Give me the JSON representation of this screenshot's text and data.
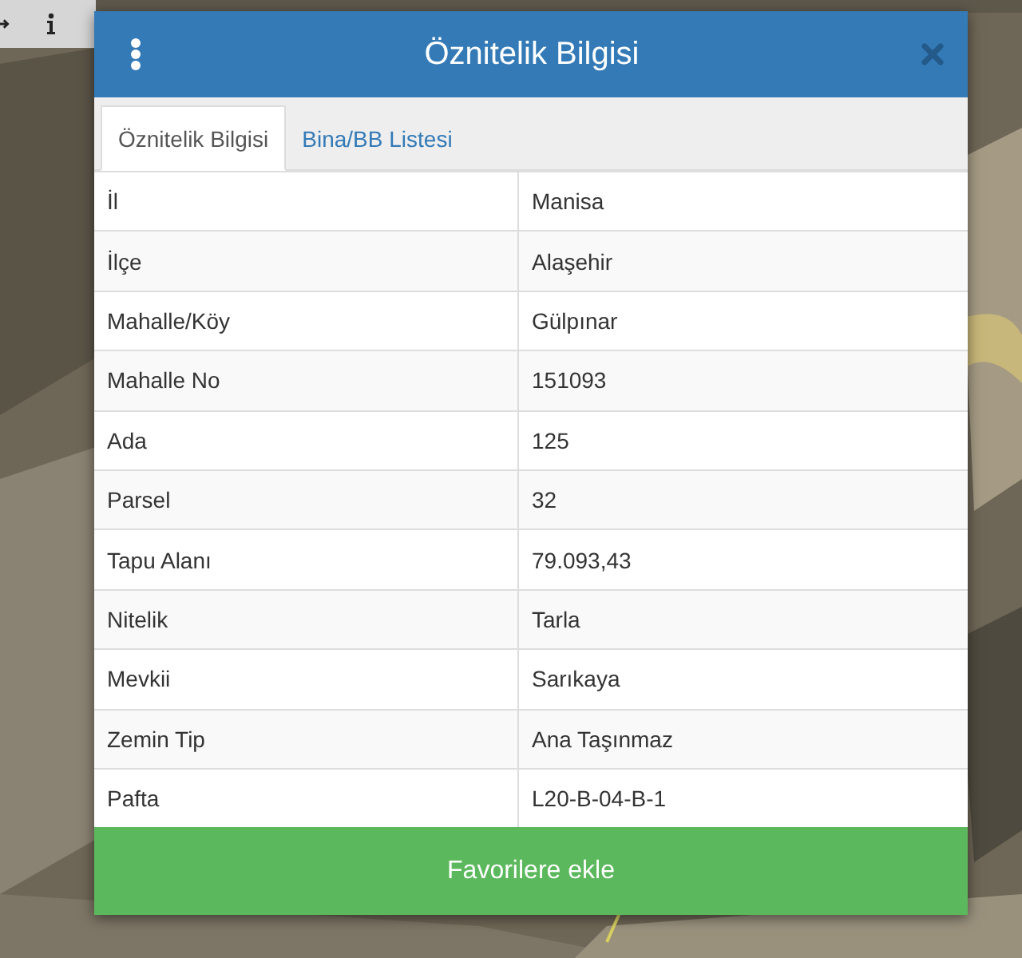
{
  "dialog": {
    "title": "Öznitelik Bilgisi"
  },
  "tabs": [
    {
      "label": "Öznitelik Bilgisi",
      "selected": true
    },
    {
      "label": "Bina/BB Listesi",
      "selected": false
    }
  ],
  "rows": [
    {
      "label": "İl",
      "value": "Manisa"
    },
    {
      "label": "İlçe",
      "value": "Alaşehir"
    },
    {
      "label": "Mahalle/Köy",
      "value": "Gülpınar"
    },
    {
      "label": "Mahalle No",
      "value": "151093"
    },
    {
      "label": "Ada",
      "value": "125"
    },
    {
      "label": "Parsel",
      "value": "32"
    },
    {
      "label": "Tapu Alanı",
      "value": "79.093,43"
    },
    {
      "label": "Nitelik",
      "value": "Tarla"
    },
    {
      "label": "Mevkii",
      "value": "Sarıkaya"
    },
    {
      "label": "Zemin Tip",
      "value": "Ana Taşınmaz"
    },
    {
      "label": "Pafta",
      "value": "L20-B-04-B-1"
    }
  ],
  "button": "Favorilere ekle"
}
